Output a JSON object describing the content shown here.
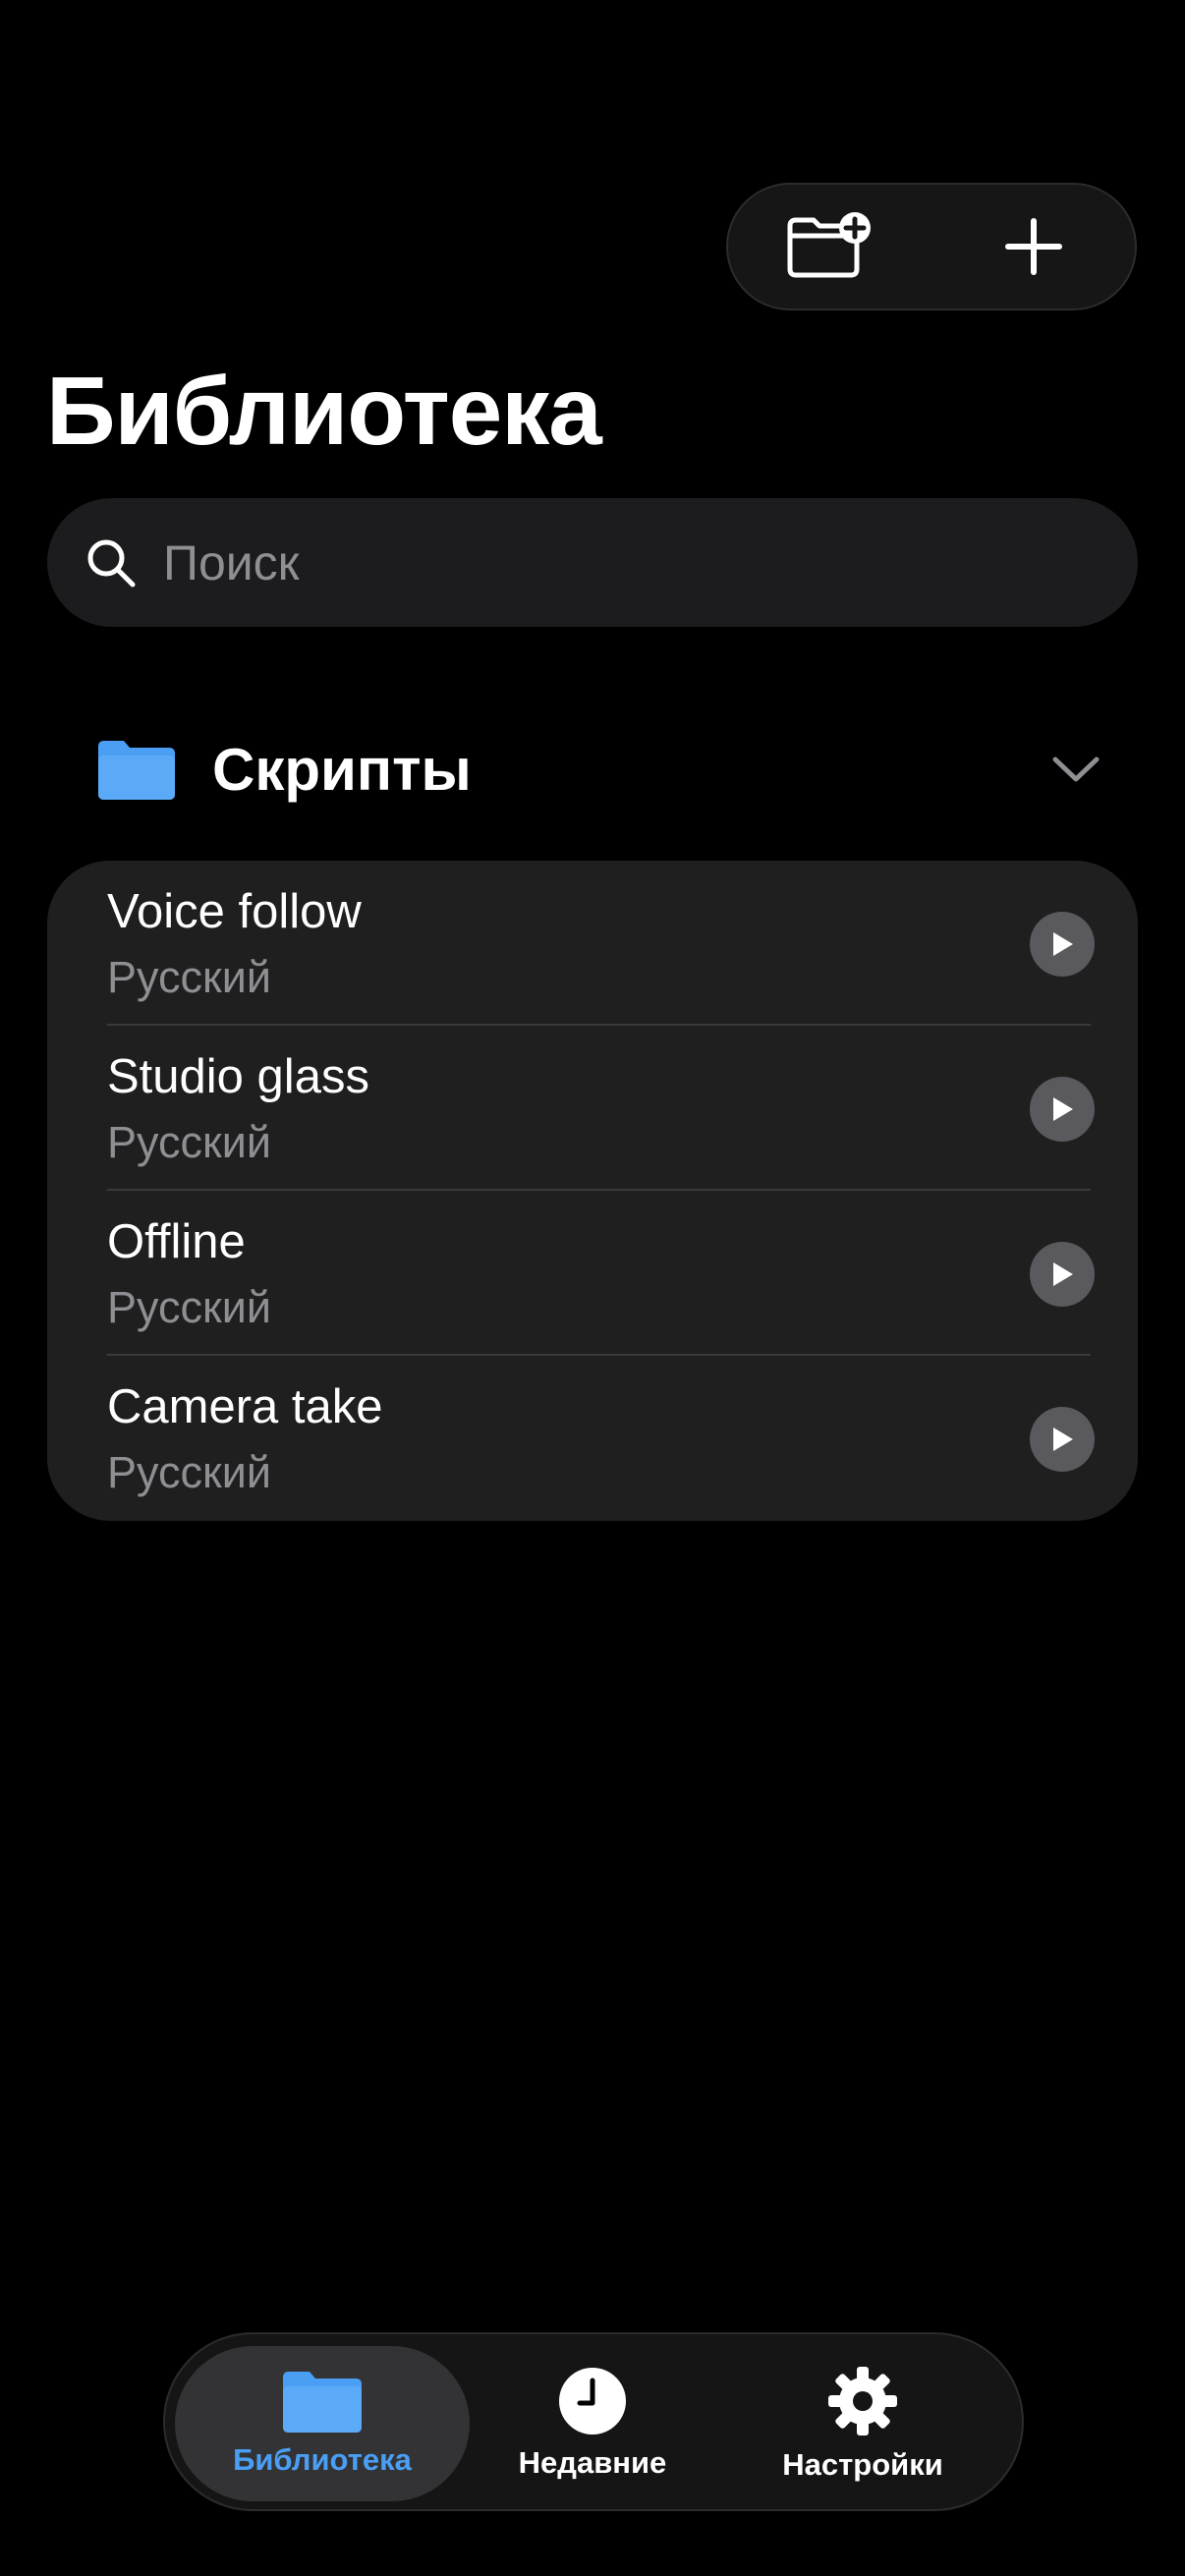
{
  "colors": {
    "background": "#000000",
    "card": "#1f1f1f",
    "accent": "#4a9ff5",
    "secondary_text": "#8e8e93"
  },
  "toolbar": {
    "new_folder_icon": "folder-badge-plus-icon",
    "add_icon": "plus-icon"
  },
  "page": {
    "title": "Библиотека"
  },
  "search": {
    "placeholder": "Поиск",
    "value": ""
  },
  "section": {
    "title": "Скрипты",
    "icon": "folder-icon",
    "toggle_icon": "chevron-down-icon"
  },
  "scripts": [
    {
      "title": "Voice follow",
      "language": "Русский"
    },
    {
      "title": "Studio glass",
      "language": "Русский"
    },
    {
      "title": "Offline",
      "language": "Русский"
    },
    {
      "title": "Camera take",
      "language": "Русский"
    }
  ],
  "tabbar": {
    "tabs": [
      {
        "label": "Библиотека",
        "icon": "folder-icon",
        "active": true
      },
      {
        "label": "Недавние",
        "icon": "clock-icon",
        "active": false
      },
      {
        "label": "Настройки",
        "icon": "gear-icon",
        "active": false
      }
    ]
  }
}
